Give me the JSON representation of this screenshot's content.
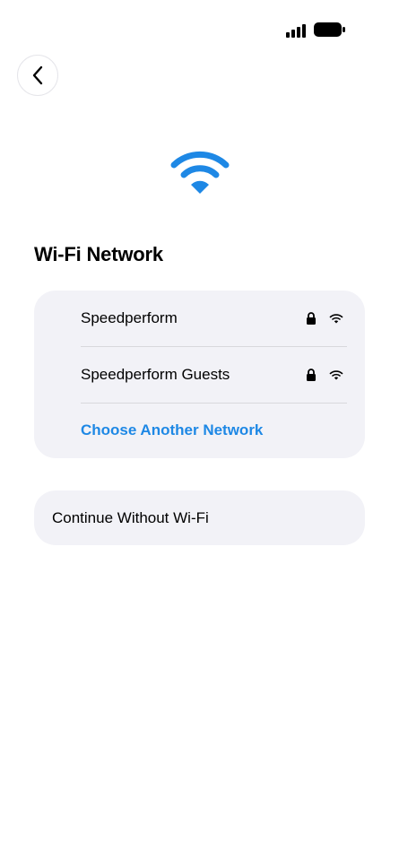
{
  "status_bar": {
    "signal_icon": "cellular-signal-icon",
    "battery_icon": "battery-icon"
  },
  "header": {
    "back_icon": "chevron-left-icon"
  },
  "hero": {
    "icon": "wifi-icon",
    "icon_color": "#1e88e5"
  },
  "title": "Wi-Fi Network",
  "networks": [
    {
      "name": "Speedperform",
      "secured": true,
      "icon": "wifi-icon"
    },
    {
      "name": "Speedperform Guests",
      "secured": true,
      "icon": "wifi-icon"
    }
  ],
  "choose_another": "Choose Another Network",
  "continue_without": "Continue Without Wi-Fi",
  "colors": {
    "accent": "#1e88e5",
    "card_background": "#f2f2f7"
  }
}
